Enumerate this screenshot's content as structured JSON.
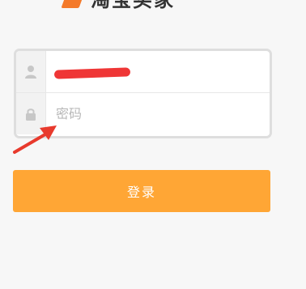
{
  "logo": {
    "icon": "logo-mark",
    "title": "淘宝买家"
  },
  "login": {
    "username_value": "",
    "password_placeholder": "密码",
    "user_icon": "user-icon",
    "lock_icon": "lock-icon",
    "button_label": "登录"
  },
  "colors": {
    "background": "#f7f7f7",
    "accent": "#ffa635",
    "annotation": "#e83a2d"
  }
}
